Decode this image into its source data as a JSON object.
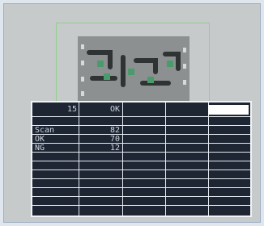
{
  "header_row": {
    "count": "15",
    "status": "OK"
  },
  "stats": [
    {
      "label": "Scan",
      "value": "82"
    },
    {
      "label": "OK",
      "value": "70"
    },
    {
      "label": "NG",
      "value": "12"
    }
  ],
  "colors": {
    "background": "#c6cacb",
    "panel": "#1e2533",
    "grid_lines": "#e6ebf2",
    "roi_outline": "#8fd08a",
    "part": "#8c9090",
    "trace_green": "#3a8a5a",
    "highlight_cell": "#ffffff"
  }
}
